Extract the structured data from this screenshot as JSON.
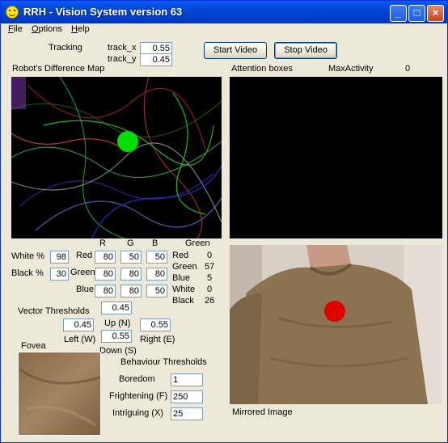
{
  "window": {
    "title": "RRH - Vision System version 63",
    "controls": {
      "minimize": "_",
      "maximize": "□",
      "close": "×"
    }
  },
  "menu": {
    "items": [
      {
        "label": "File",
        "accel": "F"
      },
      {
        "label": "Options",
        "accel": "O"
      },
      {
        "label": "Help",
        "accel": "H"
      }
    ]
  },
  "tracking": {
    "label": "Tracking",
    "x_label": "track_x",
    "x_value": "0.55",
    "y_label": "track_y",
    "y_value": "0.45"
  },
  "buttons": {
    "start": "Start Video",
    "stop": "Stop Video"
  },
  "difference_map": {
    "label": "Robot's Difference Map"
  },
  "attention": {
    "label": "Attention boxes",
    "max_label": "MaxActivity",
    "max_value": "0"
  },
  "color_grid": {
    "headers": [
      "R",
      "G",
      "B"
    ],
    "rows": [
      {
        "label": "Red",
        "values": [
          "80",
          "50",
          "50"
        ]
      },
      {
        "label": "Green",
        "values": [
          "80",
          "80",
          "80"
        ]
      },
      {
        "label": "Blue",
        "values": [
          "80",
          "80",
          "50"
        ]
      }
    ]
  },
  "white_black": {
    "white_label": "White %",
    "white_value": "98",
    "black_label": "Black %",
    "black_value": "30"
  },
  "green_stats": {
    "title": "Green",
    "rows": [
      {
        "label": "Red",
        "value": "0"
      },
      {
        "label": "Green",
        "value": "57"
      },
      {
        "label": "Blue",
        "value": "5"
      },
      {
        "label": "White",
        "value": "0"
      },
      {
        "label": "Black",
        "value": "26"
      }
    ]
  },
  "vector": {
    "label": "Vector Thresholds",
    "up_value": "0.45",
    "up_label": "Up (N)",
    "left_value": "0.45",
    "left_label": "Left (W)",
    "right_value": "0.55",
    "right_label": "Right (E)",
    "down_value": "0.55",
    "down_label": "Down (S)"
  },
  "fovea": {
    "label": "Fovea"
  },
  "behaviour": {
    "label": "Behaviour Thresholds",
    "rows": [
      {
        "label": "Boredom",
        "value": "1"
      },
      {
        "label": "Frightening (F)",
        "value": "250"
      },
      {
        "label": "Intriguing (X)",
        "value": "25"
      }
    ]
  },
  "mirrored": {
    "label": "Mirrored Image"
  },
  "colors": {
    "tracker_green": "#00e000",
    "tracker_red": "#e00000",
    "title_blue": "#0046d5"
  }
}
